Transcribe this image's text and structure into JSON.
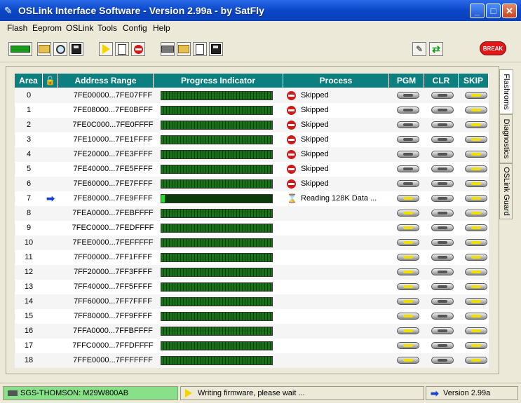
{
  "window": {
    "title": "OSLink Interface Software - Version 2.99a - by SatFly"
  },
  "menu": [
    "Flash",
    "Eeprom",
    "OSLink",
    "Tools",
    "Config",
    "Help"
  ],
  "toolbar": {
    "break_label": "BREAK"
  },
  "table": {
    "headers": {
      "area": "Area",
      "address": "Address Range",
      "progress": "Progress Indicator",
      "process": "Process",
      "pgm": "PGM",
      "clr": "CLR",
      "skip": "SKIP"
    },
    "rows": [
      {
        "area": "0",
        "address": "7FE00000...7FE07FFF",
        "progress": 1.0,
        "process": "Skipped",
        "status": "skipped"
      },
      {
        "area": "1",
        "address": "7FE08000...7FE0BFFF",
        "progress": 1.0,
        "process": "Skipped",
        "status": "skipped"
      },
      {
        "area": "2",
        "address": "7FE0C000...7FE0FFFF",
        "progress": 1.0,
        "process": "Skipped",
        "status": "skipped"
      },
      {
        "area": "3",
        "address": "7FE10000...7FE1FFFF",
        "progress": 1.0,
        "process": "Skipped",
        "status": "skipped"
      },
      {
        "area": "4",
        "address": "7FE20000...7FE3FFFF",
        "progress": 1.0,
        "process": "Skipped",
        "status": "skipped"
      },
      {
        "area": "5",
        "address": "7FE40000...7FE5FFFF",
        "progress": 1.0,
        "process": "Skipped",
        "status": "skipped"
      },
      {
        "area": "6",
        "address": "7FE60000...7FE7FFFF",
        "progress": 1.0,
        "process": "Skipped",
        "status": "skipped"
      },
      {
        "area": "7",
        "address": "7FE80000...7FE9FFFF",
        "progress": 0.02,
        "process": "Reading 128K Data ...",
        "status": "active"
      },
      {
        "area": "8",
        "address": "7FEA0000...7FEBFFFF",
        "progress": 1.0,
        "process": "",
        "status": "pending"
      },
      {
        "area": "9",
        "address": "7FEC0000...7FEDFFFF",
        "progress": 1.0,
        "process": "",
        "status": "pending"
      },
      {
        "area": "10",
        "address": "7FEE0000...7FEFFFFF",
        "progress": 1.0,
        "process": "",
        "status": "pending"
      },
      {
        "area": "11",
        "address": "7FF00000...7FF1FFFF",
        "progress": 1.0,
        "process": "",
        "status": "pending"
      },
      {
        "area": "12",
        "address": "7FF20000...7FF3FFFF",
        "progress": 1.0,
        "process": "",
        "status": "pending"
      },
      {
        "area": "13",
        "address": "7FF40000...7FF5FFFF",
        "progress": 1.0,
        "process": "",
        "status": "pending"
      },
      {
        "area": "14",
        "address": "7FF60000...7FF7FFFF",
        "progress": 1.0,
        "process": "",
        "status": "pending"
      },
      {
        "area": "15",
        "address": "7FF80000...7FF9FFFF",
        "progress": 1.0,
        "process": "",
        "status": "pending"
      },
      {
        "area": "16",
        "address": "7FFA0000...7FFBFFFF",
        "progress": 1.0,
        "process": "",
        "status": "pending"
      },
      {
        "area": "17",
        "address": "7FFC0000...7FFDFFFF",
        "progress": 1.0,
        "process": "",
        "status": "pending"
      },
      {
        "area": "18",
        "address": "7FFE0000...7FFFFFFF",
        "progress": 1.0,
        "process": "",
        "status": "pending"
      }
    ]
  },
  "side_tabs": [
    "Flashroms",
    "Diagnostics",
    "OSLink Guard"
  ],
  "status": {
    "device": "SGS-THOMSON: M29W800AB",
    "message": "Writing firmware, please wait ...",
    "version": "Version 2.99a"
  }
}
